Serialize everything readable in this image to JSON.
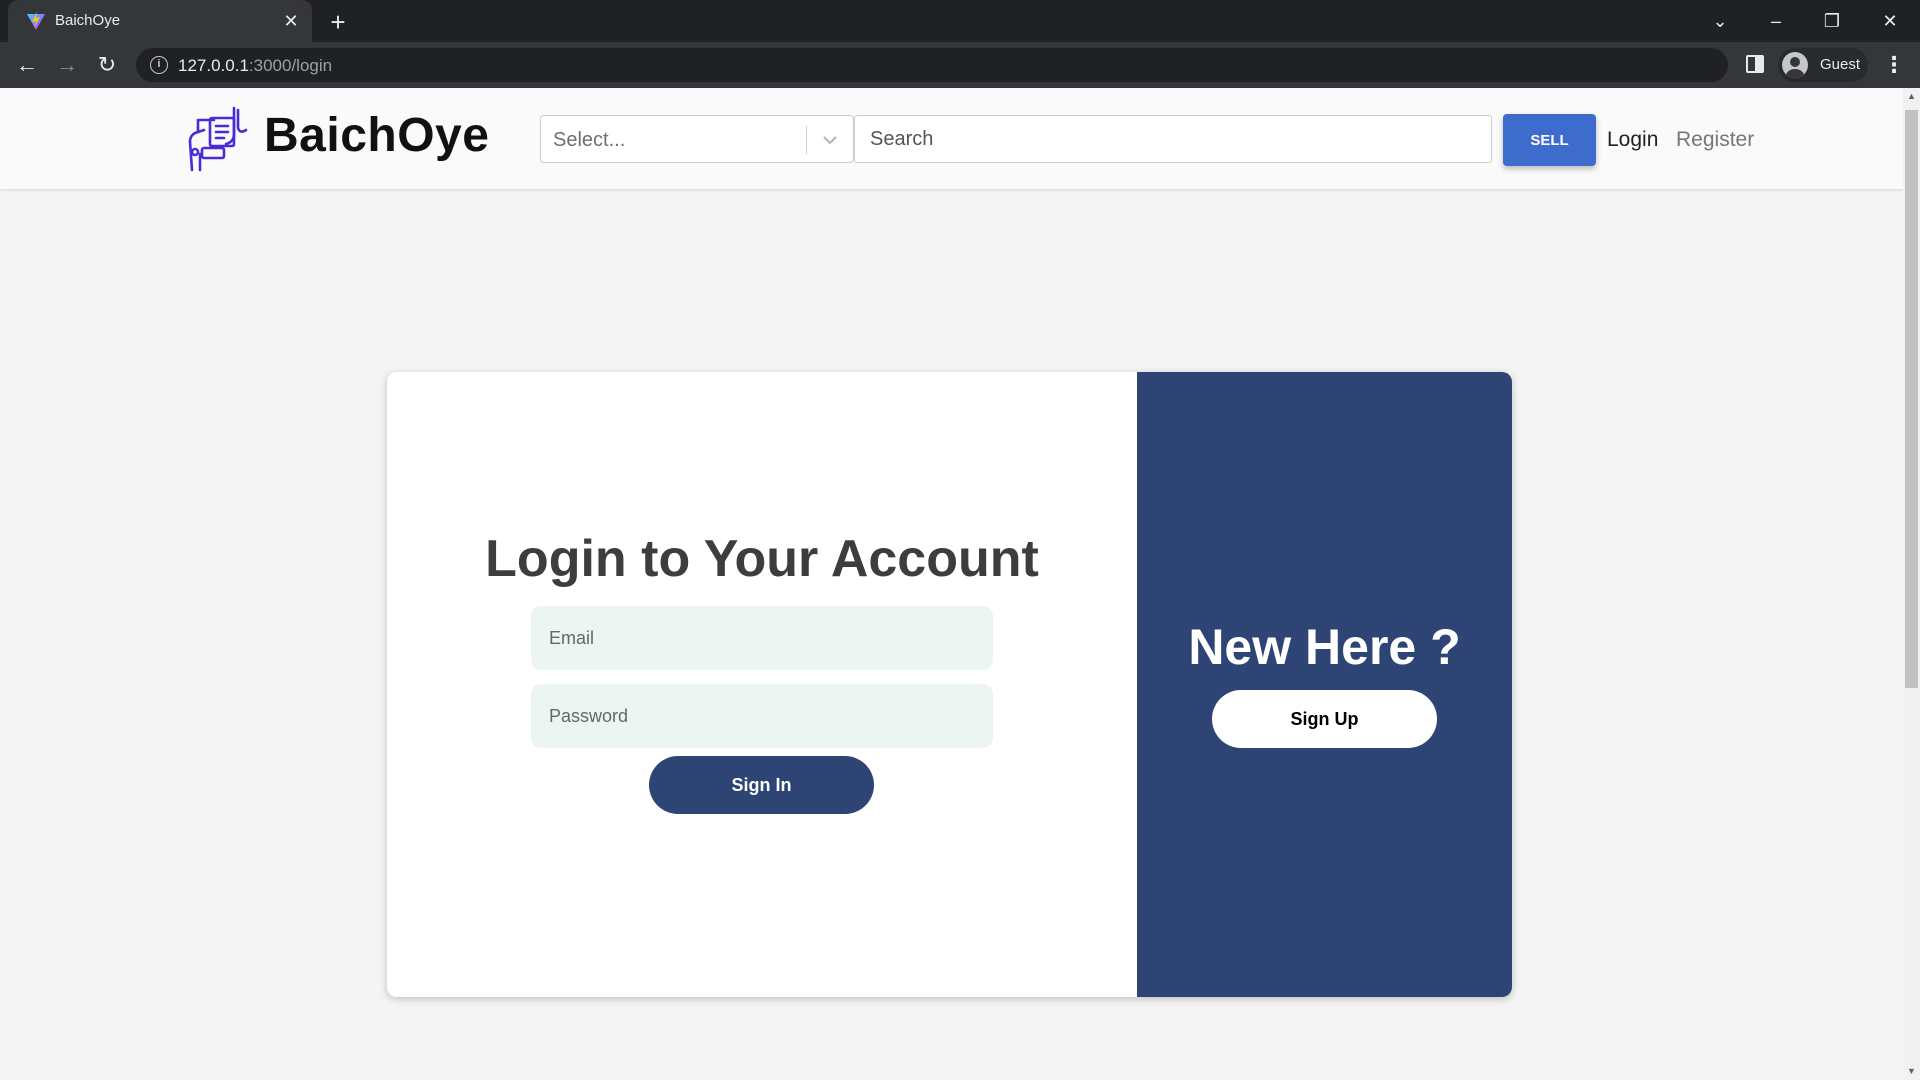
{
  "browser": {
    "tab_title": "BaichOye",
    "url_host": "127.0.0.1",
    "url_path": ":3000/login",
    "profile_name": "Guest",
    "icons": [
      "back-arrow-icon",
      "forward-arrow-icon",
      "reload-icon",
      "site-info-icon",
      "side-panel-icon",
      "profile-avatar-icon",
      "more-menu-icon"
    ]
  },
  "header": {
    "logo_text": "BaichOye",
    "category_select": {
      "value": "Select..."
    },
    "search": {
      "placeholder": "Search"
    },
    "sell_label": "SELL",
    "login_label": "Login",
    "register_label": "Register"
  },
  "login": {
    "title": "Login to Your Account",
    "email_placeholder": "Email",
    "password_placeholder": "Password",
    "signin_label": "Sign In"
  },
  "signup_panel": {
    "title": "New Here ?",
    "signup_label": "Sign Up"
  },
  "colors": {
    "primary_navy": "#2e4475",
    "sell_blue": "#3d6ccc",
    "input_bg": "#edf5f3",
    "page_bg": "#f4f4f4",
    "logo_purple": "#4a2bd6"
  }
}
